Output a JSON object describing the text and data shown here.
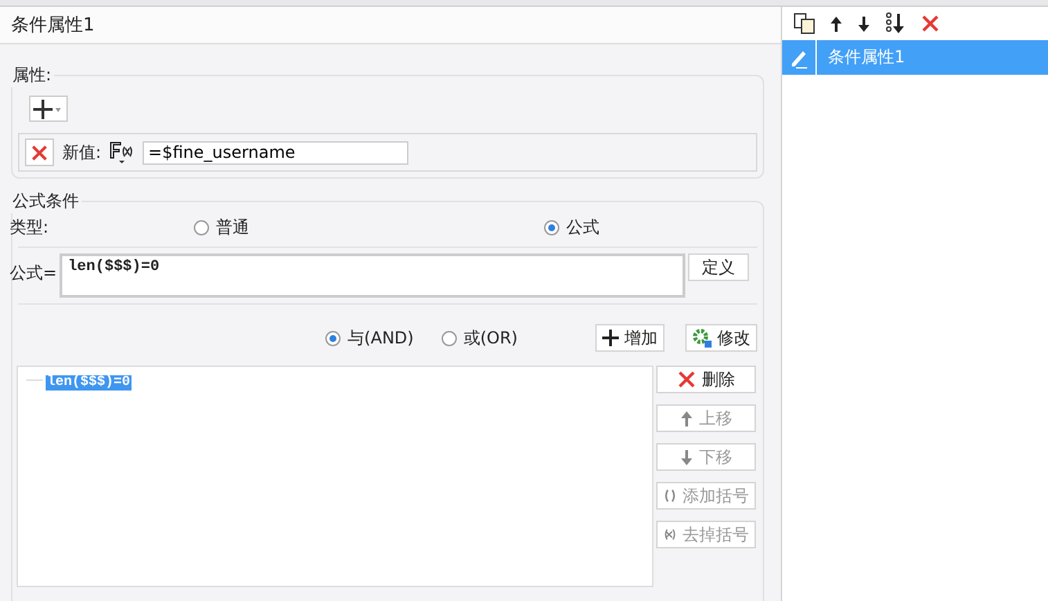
{
  "title": "条件属性1",
  "properties": {
    "legend": "属性:",
    "rows": [
      {
        "label": "新值:",
        "value": "=$fine_username"
      }
    ]
  },
  "formula_condition": {
    "legend": "公式条件",
    "type_label": "类型:",
    "types": [
      {
        "label": "普通",
        "selected": false
      },
      {
        "label": "公式",
        "selected": true
      }
    ],
    "formula_label": "公式=",
    "formula": "len($$$)=0",
    "define_button": "定义",
    "logic": [
      {
        "label": "与(AND)",
        "selected": true
      },
      {
        "label": "或(OR)",
        "selected": false
      }
    ],
    "add_button": "增加",
    "modify_button": "修改",
    "conditions": [
      {
        "text": "len($$$)=0",
        "selected": true
      }
    ],
    "actions": [
      {
        "kind": "delete",
        "label": "删除",
        "disabled": false
      },
      {
        "kind": "up",
        "label": "上移",
        "disabled": true
      },
      {
        "kind": "down",
        "label": "下移",
        "disabled": true
      },
      {
        "kind": "add-brackets",
        "label": "添加括号",
        "disabled": true
      },
      {
        "kind": "remove-brackets",
        "label": "去掉括号",
        "disabled": true
      }
    ]
  },
  "side_list": {
    "items": [
      {
        "label": "条件属性1",
        "selected": true
      }
    ]
  }
}
